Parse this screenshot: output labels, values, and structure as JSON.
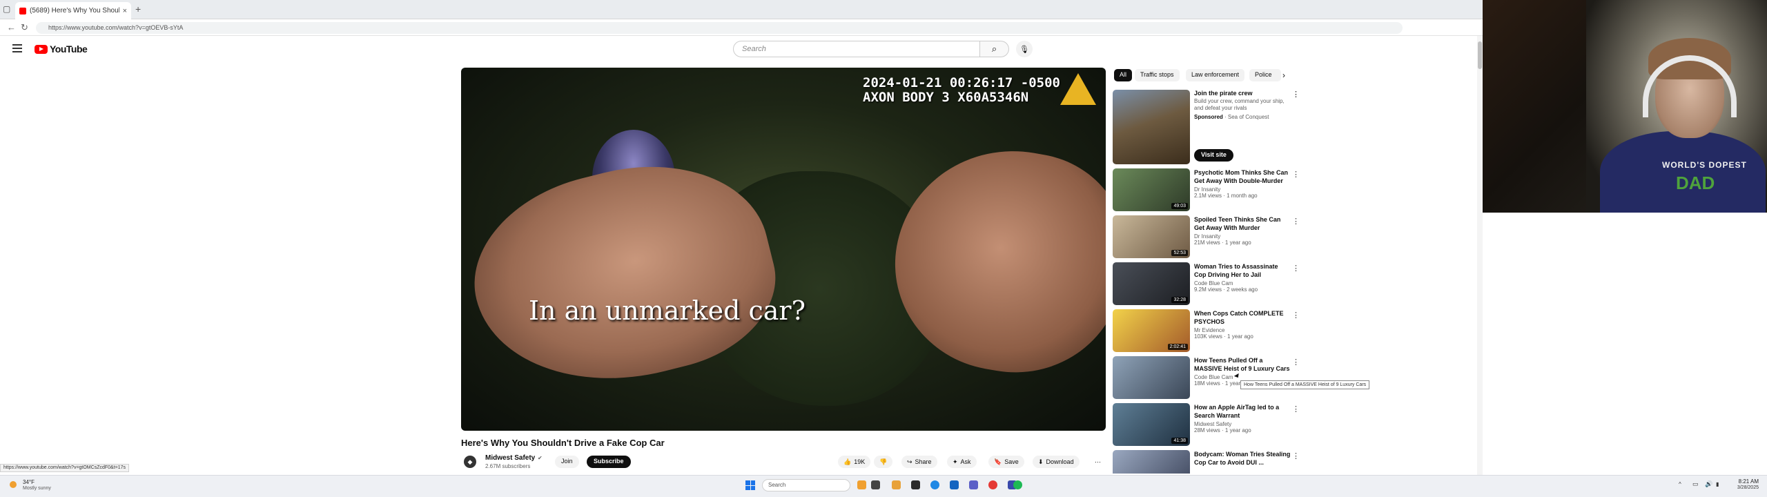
{
  "browser": {
    "tab_title": "(5689) Here's Why You Shoul",
    "url": "https://www.youtube.com/watch?v=gtOEVB-sYtA",
    "status_url": "https://www.youtube.com/watch?v=gtOMCsZcdF0&t=17s"
  },
  "header": {
    "logo_text": "YouTube",
    "search_placeholder": "Search"
  },
  "player": {
    "timestamp": "2024-01-21 00:26:17 -0500",
    "device": "AXON BODY 3 X60A5346N",
    "caption": "In an unmarked car?"
  },
  "video": {
    "title": "Here's Why You Shouldn't Drive a Fake Cop Car",
    "channel": "Midwest Safety",
    "subscribers": "2.67M subscribers",
    "join_label": "Join",
    "subscribe_label": "Subscribe",
    "like_count": "19K",
    "share_label": "Share",
    "ask_label": "Ask",
    "save_label": "Save",
    "download_label": "Download"
  },
  "chips": [
    "All",
    "Traffic stops",
    "Law enforcement",
    "Police"
  ],
  "ad": {
    "title": "Join the pirate crew",
    "desc": "Build your crew, command your ship, and defeat your rivals",
    "sponsored": "Sponsored",
    "advertiser": "Sea of Conquest",
    "cta": "Visit site"
  },
  "recommendations": [
    {
      "title": "Psychotic Mom Thinks She Can Get Away With Double-Murder",
      "channel": "Dr Insanity",
      "meta": "2.1M views · 1 month ago",
      "duration": "49:03"
    },
    {
      "title": "Spoiled Teen Thinks She Can Get Away With Murder",
      "channel": "Dr Insanity",
      "meta": "21M views · 1 year ago",
      "duration": "52:53"
    },
    {
      "title": "Woman Tries to Assassinate Cop Driving Her to Jail",
      "channel": "Code Blue Cam",
      "meta": "9.2M views · 2 weeks ago",
      "duration": "32:28"
    },
    {
      "title": "When Cops Catch COMPLETE PSYCHOS",
      "channel": "Mr Evidence",
      "meta": "103K views · 1 year ago",
      "duration": "2:02:41"
    },
    {
      "title": "How Teens Pulled Off a MASSIVE Heist of 9 Luxury Cars",
      "channel": "Code Blue Cam",
      "meta": "18M views · 1 year ago",
      "duration": ""
    },
    {
      "title": "How an Apple AirTag led to a Search Warrant",
      "channel": "Midwest Safety",
      "meta": "28M views · 1 year ago",
      "duration": "41:38"
    },
    {
      "title": "Bodycam: Woman Tries Stealing Cop Car to Avoid DUI ...",
      "channel": "",
      "meta": "",
      "duration": ""
    }
  ],
  "tooltip": "How Teens Pulled Off a MASSIVE Heist of 9 Luxury Cars",
  "webcam": {
    "hoodie_text": "WORLD'S DOPEST",
    "hoodie_big": "DAD"
  },
  "taskbar": {
    "temp": "34°F",
    "weather": "Mostly sunny",
    "search": "Search",
    "time": "8:21 AM",
    "date": "3/28/2025"
  }
}
